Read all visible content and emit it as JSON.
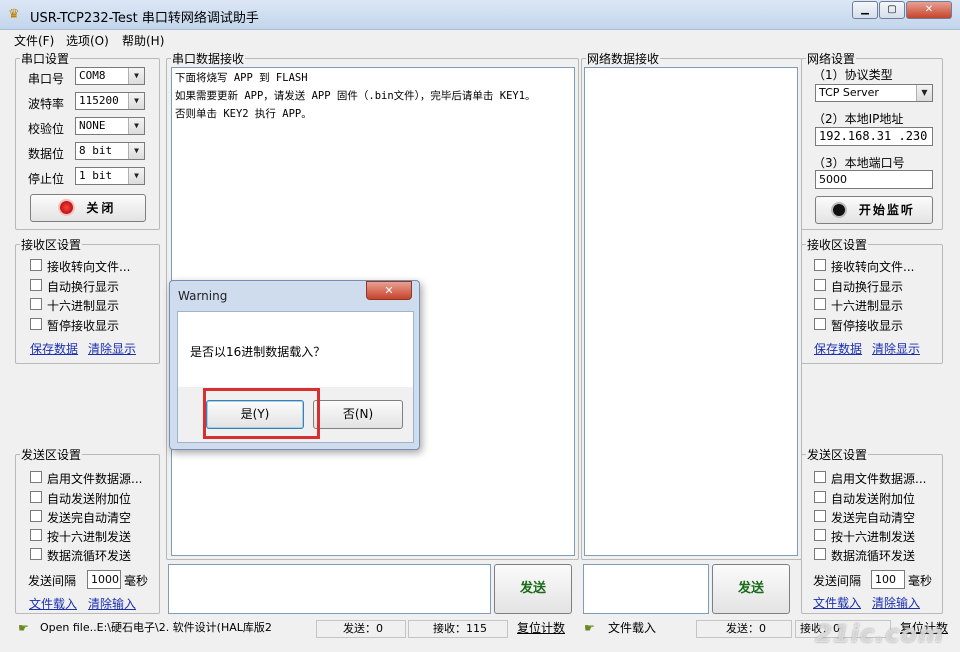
{
  "window": {
    "title": "USR-TCP232-Test 串口转网络调试助手",
    "buttons": [
      "▁",
      "▢",
      "✕"
    ]
  },
  "menu": [
    "文件(F)",
    "选项(O)",
    "帮助(H)"
  ],
  "serial_settings": {
    "legend": "串口设置",
    "port_label": "串口号",
    "port_value": "COM8",
    "baud_label": "波特率",
    "baud_value": "115200",
    "parity_label": "校验位",
    "parity_value": "NONE",
    "databits_label": "数据位",
    "databits_value": "8 bit",
    "stopbits_label": "停止位",
    "stopbits_value": "1 bit",
    "close_button": "关闭"
  },
  "left_recv_settings": {
    "legend": "接收区设置",
    "options": [
      "接收转向文件...",
      "自动换行显示",
      "十六进制显示",
      "暂停接收显示"
    ],
    "save_link": "保存数据",
    "clear_link": "清除显示"
  },
  "left_send_settings": {
    "legend": "发送区设置",
    "options": [
      "启用文件数据源...",
      "自动发送附加位",
      "发送完自动清空",
      "按十六进制发送",
      "数据流循环发送"
    ],
    "interval_label": "发送间隔",
    "interval_value": "1000",
    "interval_unit": "毫秒",
    "load_link": "文件载入",
    "clear_link": "清除输入"
  },
  "serial_recv": {
    "legend": "串口数据接收",
    "lines": [
      "下面将烧写 APP 到 FLASH",
      "如果需要更新 APP，请发送 APP 固件（.bin文件），完毕后请单击 KEY1。",
      "否则单击 KEY2 执行 APP。"
    ]
  },
  "net_recv": {
    "legend": "网络数据接收"
  },
  "net_settings": {
    "legend": "网络设置",
    "protocol_label": "（1）协议类型",
    "protocol_value": "TCP Server",
    "ip_label": "（2）本地IP地址",
    "ip_value": "192.168.31 .230",
    "port_label": "（3）本地端口号",
    "port_value": "5000",
    "listen_button": "开始监听"
  },
  "right_recv_settings": {
    "legend": "接收区设置",
    "options": [
      "接收转向文件...",
      "自动换行显示",
      "十六进制显示",
      "暂停接收显示"
    ],
    "save_link": "保存数据",
    "clear_link": "清除显示"
  },
  "right_send_settings": {
    "legend": "发送区设置",
    "options": [
      "启用文件数据源...",
      "自动发送附加位",
      "发送完自动清空",
      "按十六进制发送",
      "数据流循环发送"
    ],
    "interval_label": "发送间隔",
    "interval_value": "100",
    "interval_unit": "毫秒",
    "load_link": "文件载入",
    "clear_link": "清除输入"
  },
  "send_buttons": {
    "serial": "发送",
    "net": "发送"
  },
  "status": {
    "left_file": "Open file..E:\\硬石电子\\2. 软件设计(HAL库版2",
    "left_sent": "发送：0",
    "left_recv": "接收：115",
    "left_reset": "复位计数",
    "right_file": "文件载入",
    "right_sent": "发送：0",
    "right_recv": "接收：0",
    "right_reset": "复位计数"
  },
  "dialog": {
    "title": "Warning",
    "close": "✕",
    "message": "是否以16进制数据载入？",
    "yes": "是(Y)",
    "no": "否(N)"
  },
  "watermark": "21ic.com"
}
